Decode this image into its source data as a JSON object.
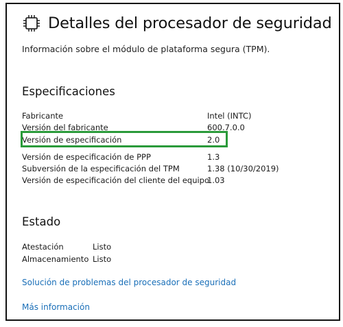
{
  "header": {
    "title": "Detalles del procesador de seguridad",
    "icon": "processor-chip-icon"
  },
  "subtitle": "Información sobre el módulo de plataforma segura (TPM).",
  "specs": {
    "heading": "Especificaciones",
    "rows": [
      {
        "label": "Fabricante",
        "value": "Intel (INTC)"
      },
      {
        "label": "Versión del fabricante",
        "value": "600.7.0.0"
      },
      {
        "label": "Versión de especificación",
        "value": "2.0"
      },
      {
        "label": "Versión de especificación de PPP",
        "value": "1.3"
      },
      {
        "label": "Subversión de la especificación del TPM",
        "value": "1.38 (10/30/2019)"
      },
      {
        "label": "Versión de especificación del cliente del equipo",
        "value": "1.03"
      }
    ],
    "highlight_color": "#2a9a3a"
  },
  "status": {
    "heading": "Estado",
    "rows": [
      {
        "label": "Atestación",
        "value": "Listo"
      },
      {
        "label": "Almacenamiento",
        "value": "Listo"
      }
    ]
  },
  "links": {
    "troubleshoot": "Solución de problemas del procesador de seguridad",
    "more_info": "Más información",
    "color": "#1a6fb8"
  }
}
